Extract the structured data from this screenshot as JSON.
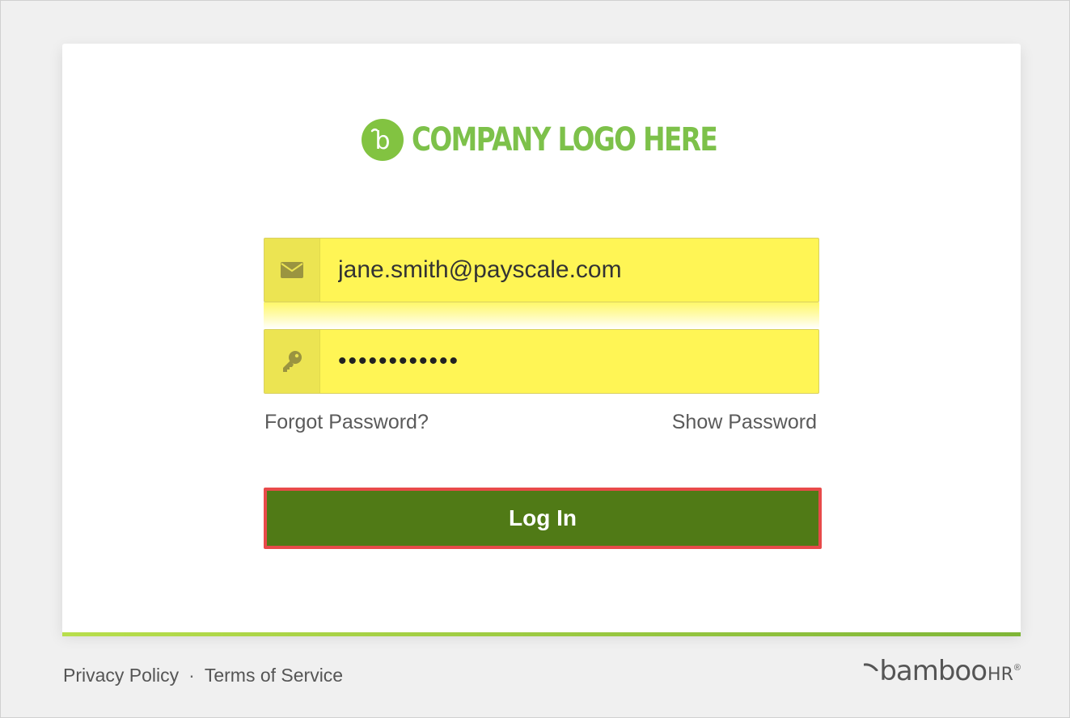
{
  "logo": {
    "text": "COMPANY LOGO HERE",
    "mark_letter": "b",
    "color": "#7dc14a"
  },
  "login_form": {
    "email": {
      "value": "jane.smith@payscale.com",
      "icon": "envelope-icon"
    },
    "password": {
      "value": "••••••••••••",
      "icon": "key-icon"
    },
    "forgot_password_label": "Forgot Password?",
    "show_password_label": "Show Password",
    "login_button_label": "Log In",
    "login_button_color": "#507a16",
    "highlight_color": "#e84a4a"
  },
  "footer": {
    "privacy_label": "Privacy Policy",
    "separator": "·",
    "terms_label": "Terms of Service",
    "brand_word": "bamboo",
    "brand_suffix": "HR",
    "brand_reg": "®"
  }
}
